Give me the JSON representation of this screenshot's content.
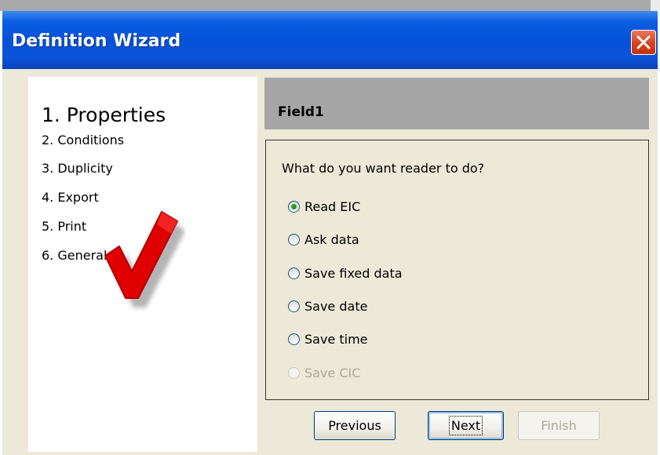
{
  "window": {
    "title": "Definition Wizard"
  },
  "steps": [
    {
      "label": "1. Properties",
      "current": true
    },
    {
      "label": "2. Conditions"
    },
    {
      "label": "3. Duplicity"
    },
    {
      "label": "4. Export"
    },
    {
      "label": "5. Print"
    },
    {
      "label": "6. General"
    }
  ],
  "field": {
    "name": "Field1",
    "question": "What do you want reader to do?",
    "options": [
      {
        "label": "Read EIC",
        "checked": true
      },
      {
        "label": "Ask data"
      },
      {
        "label": "Save fixed data"
      },
      {
        "label": "Save date"
      },
      {
        "label": "Save time"
      },
      {
        "label": "Save CIC",
        "disabled": true
      }
    ]
  },
  "buttons": {
    "previous": "Previous",
    "next": "Next",
    "finish": "Finish"
  },
  "colors": {
    "titlebar": "#0551d8",
    "close_button": "#d6411d",
    "checkmark": "#e00000",
    "header_bg": "#a6a6a6",
    "window_bg": "#ece9d8"
  },
  "icons": {
    "close": "close-icon",
    "decoration": "checkmark-icon"
  }
}
